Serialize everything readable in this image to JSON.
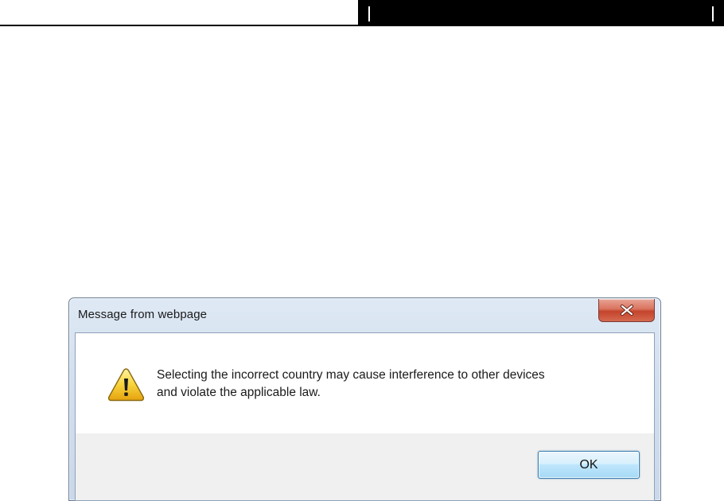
{
  "dialog": {
    "title": "Message from webpage",
    "message_lines": [
      "Selecting the incorrect country may cause interference to other devices",
      "and violate the applicable law."
    ],
    "icon": "warning-icon",
    "ok_label": "OK",
    "close_icon": "close-icon"
  },
  "colors": {
    "header_bar": "#000000",
    "close_button": "#c4442c",
    "ok_button_border": "#3c7fb1",
    "button_area": "#f0f0f0"
  }
}
